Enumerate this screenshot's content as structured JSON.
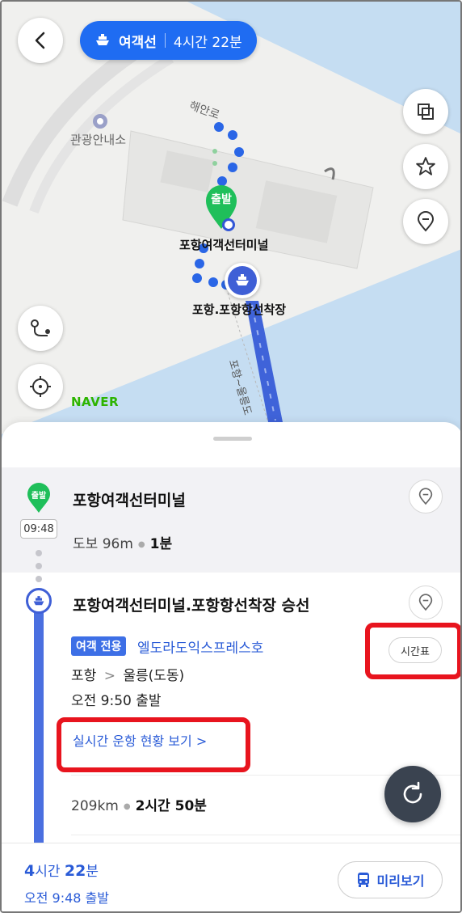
{
  "header": {
    "mode_label": "여객선",
    "duration": "4시간 22분"
  },
  "map": {
    "labels": {
      "info_center": "관광안내소",
      "road": "해안로",
      "start_badge": "출발",
      "terminal": "포항여객선터미널",
      "port": "포항.포항항선착장",
      "route_name": "포항~울릉도"
    },
    "watermark": "NAVER"
  },
  "segments": {
    "walk": {
      "badge": "출발",
      "time": "09:48",
      "title": "포항여객선터미널",
      "mode": "도보",
      "distance": "96m",
      "duration": "1분"
    },
    "ferry": {
      "title": "포항여객선터미널.포항항선착장 승선",
      "tag": "여객 전용",
      "ship_name": "엘도라도익스프레스호",
      "route_from": "포항",
      "route_to": "울릉(도동)",
      "departure": "오전 9:50 출발",
      "timetable_label": "시간표",
      "realtime_link": "실시간 운항 현황 보기",
      "distance": "209km",
      "duration": "2시간 50분"
    }
  },
  "footer": {
    "total_hours": "4",
    "total_hours_unit": "시간",
    "total_minutes": "22",
    "total_minutes_unit": "분",
    "departure": "오전 9:48 출발",
    "preview_label": "미리보기"
  },
  "colors": {
    "accent": "#1f6cf2",
    "route_blue": "#4a6fe0",
    "start_green": "#1fbf5a",
    "highlight_red": "#e8141e",
    "water": "#c5ddf2"
  }
}
